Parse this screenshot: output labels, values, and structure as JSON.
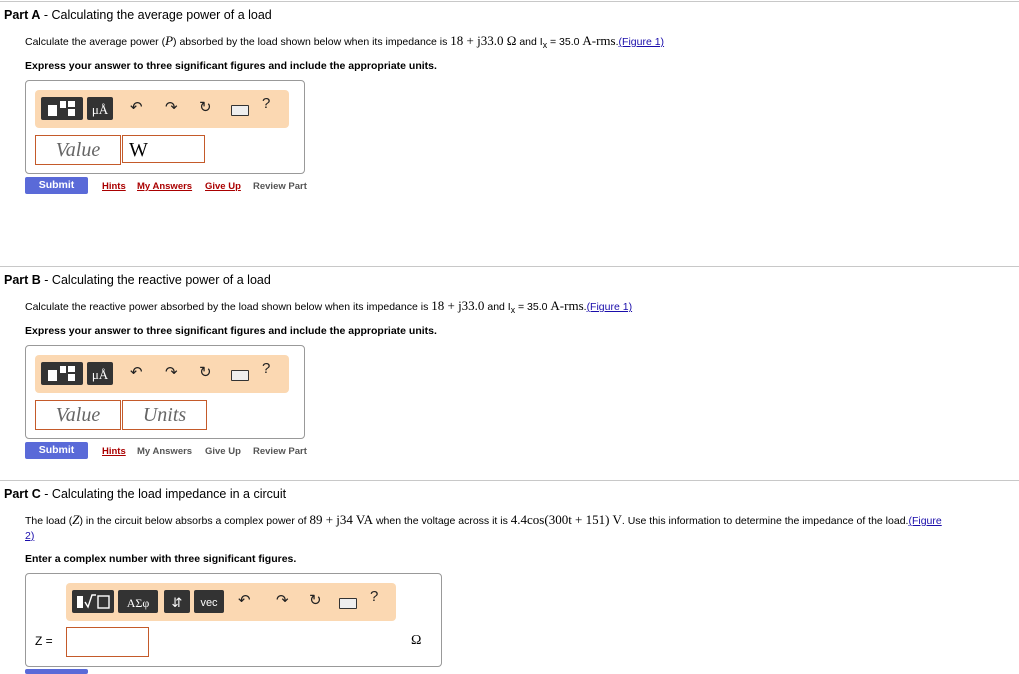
{
  "partA": {
    "label": "Part A",
    "title": " - Calculating the average power of a load",
    "q_prefix": "Calculate the average power (",
    "q_sym": "P",
    "q_mid": ") absorbed by the load shown below when its impedance is ",
    "q_z": "18 + j33.0 Ω",
    "q_and": " and I",
    "q_sub": "x",
    "q_eq": " = 35.0 ",
    "q_unit": "A-rms",
    "q_dot": ".",
    "figure_link": "(Figure 1)",
    "instruction": "Express your answer to three significant figures and include the appropriate units.",
    "value_placeholder": "Value",
    "unit_value": "W",
    "submit": "Submit",
    "hints": "Hints",
    "my_answers": "My Answers",
    "give_up": "Give Up",
    "review": "Review Part"
  },
  "partB": {
    "label": "Part B",
    "title": " - Calculating the reactive power of a load",
    "q_text": "Calculate the reactive power absorbed by the load shown below when its impedance is ",
    "q_z": "18 + j33.0",
    "q_and": " and I",
    "q_sub": "x",
    "q_eq": " = 35.0 ",
    "q_unit": "A-rms",
    "q_dot": ".",
    "figure_link": "(Figure 1)",
    "instruction": "Express your answer to three significant figures and include the appropriate units.",
    "value_placeholder": "Value",
    "units_placeholder": "Units",
    "submit": "Submit",
    "hints": "Hints",
    "my_answers": "My Answers",
    "give_up": "Give Up",
    "review": "Review Part"
  },
  "partC": {
    "label": "Part C",
    "title": " - Calculating the load impedance in a circuit",
    "q_a": "The load (",
    "q_sym": "Z",
    "q_b": ") in the circuit below absorbs a complex power of ",
    "q_power": "89 + j34 VA",
    "q_c": " when the voltage across it is ",
    "q_volt": "4.4cos(300t + 151) V",
    "q_d": ". Use this information to determine the impedance of the load.",
    "figure_link_1": "(Figure",
    "figure_link_2": "2)",
    "instruction": "Enter a complex number with three significant figures.",
    "greek_btn": "ΑΣφ",
    "vec_btn": "vec",
    "z_label": "Z =",
    "ohm": "Ω"
  },
  "toolbar": {
    "mu_label": "μÅ",
    "help": "?"
  }
}
